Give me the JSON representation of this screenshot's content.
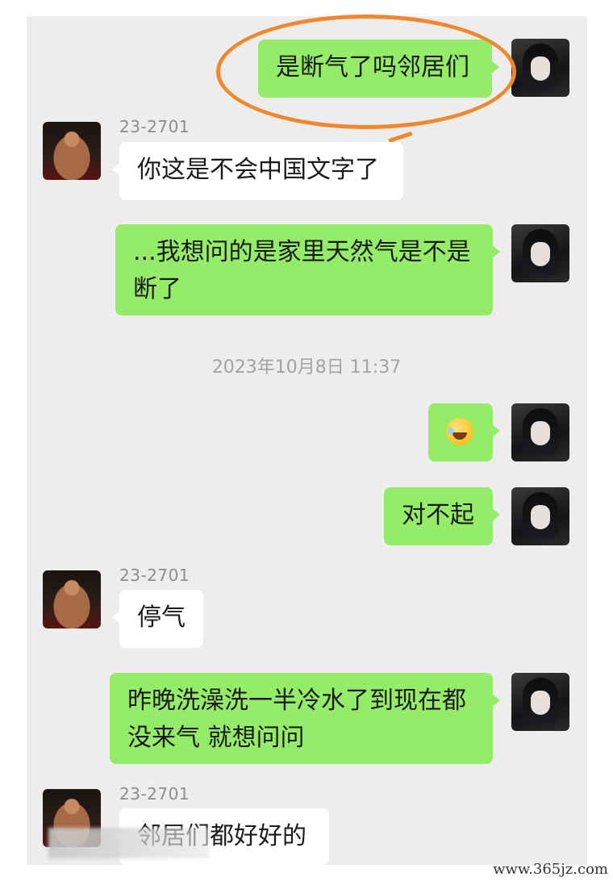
{
  "messages": [
    {
      "sender": "",
      "text": "是断气了吗邻居们"
    },
    {
      "sender": "23-2701",
      "text": "你这是不会中国文字了"
    },
    {
      "sender": "",
      "line1": "...我想问的是家里天然气是不是",
      "line2": "断了"
    },
    {
      "sender": "",
      "emoji": "face-with-tears-of-joy-icon"
    },
    {
      "sender": "",
      "text": "对不起"
    },
    {
      "sender": "23-2701",
      "text": "停气"
    },
    {
      "sender": "",
      "line1": "昨晚洗澡洗一半冷水了到现在都",
      "line2": "没来气 就想问问"
    },
    {
      "sender": "23-2701",
      "text": "邻居们都好好的"
    }
  ],
  "timestamp": "2023年10月8日 11:37",
  "watermark": "www.365jz.com",
  "colors": {
    "chat_background": "#ededed",
    "outgoing_bubble": "#95ec69",
    "incoming_bubble": "#ffffff",
    "highlight_ring": "#f0882f"
  }
}
